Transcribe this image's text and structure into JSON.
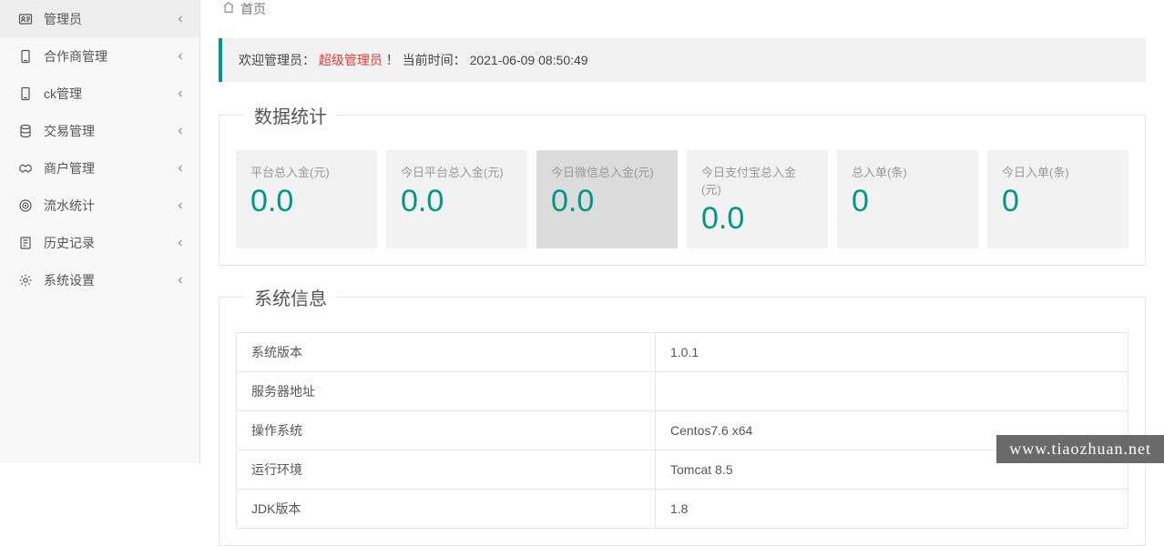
{
  "sidebar": {
    "items": [
      {
        "label": "管理员",
        "icon": "id-card"
      },
      {
        "label": "合作商管理",
        "icon": "device"
      },
      {
        "label": "ck管理",
        "icon": "device"
      },
      {
        "label": "交易管理",
        "icon": "database"
      },
      {
        "label": "商户管理",
        "icon": "handshake"
      },
      {
        "label": "流水统计",
        "icon": "target"
      },
      {
        "label": "历史记录",
        "icon": "note"
      },
      {
        "label": "系统设置",
        "icon": "gear"
      }
    ]
  },
  "breadcrumb": {
    "home": "首页"
  },
  "welcome": {
    "prefix": "欢迎管理员：",
    "admin": "超级管理员",
    "suffix": "！ 当前时间：",
    "time": "2021-06-09 08:50:49"
  },
  "stats": {
    "title": "数据统计",
    "cards": [
      {
        "label": "平台总入金(元)",
        "value": "0.0"
      },
      {
        "label": "今日平台总入金(元)",
        "value": "0.0"
      },
      {
        "label": "今日微信总入金(元)",
        "value": "0.0",
        "active": true
      },
      {
        "label": "今日支付宝总入金(元)",
        "value": "0.0"
      },
      {
        "label": "总入单(条)",
        "value": "0"
      },
      {
        "label": "今日入单(条)",
        "value": "0"
      }
    ]
  },
  "sysinfo": {
    "title": "系统信息",
    "rows": [
      {
        "key": "系统版本",
        "value": "1.0.1"
      },
      {
        "key": "服务器地址",
        "value": ""
      },
      {
        "key": "操作系统",
        "value": "Centos7.6 x64"
      },
      {
        "key": "运行环境",
        "value": "Tomcat 8.5"
      },
      {
        "key": "JDK版本",
        "value": "1.8"
      }
    ]
  },
  "watermark": "www.tiaozhuan.net"
}
